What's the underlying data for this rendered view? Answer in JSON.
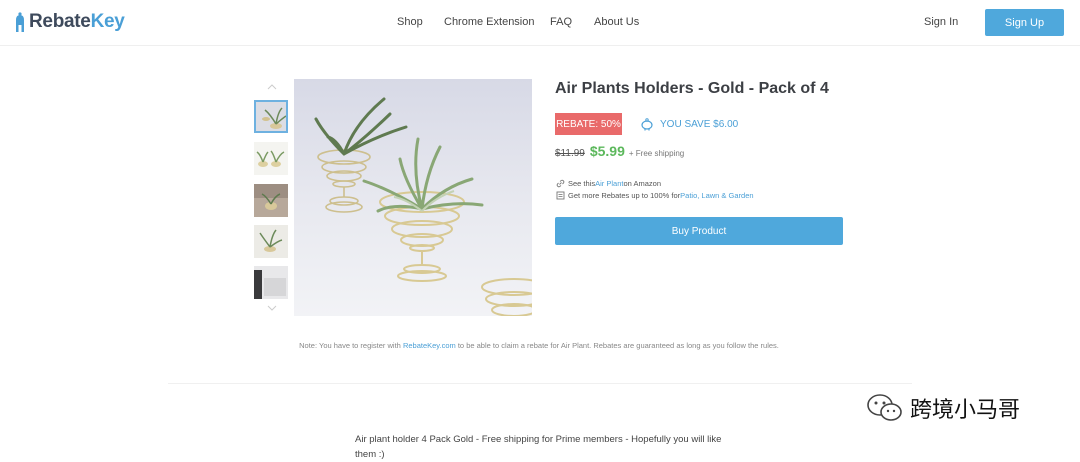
{
  "brand": {
    "name_part1": "Rebate",
    "name_part2": "Key"
  },
  "nav": {
    "items": [
      {
        "label": "Shop"
      },
      {
        "label": "Chrome Extension"
      },
      {
        "label": "FAQ"
      },
      {
        "label": "About Us"
      }
    ],
    "sign_in": "Sign In",
    "sign_up": "Sign Up"
  },
  "product": {
    "title": "Air Plants Holders - Gold - Pack of 4",
    "rebate_badge": "REBATE: 50%",
    "you_save": "YOU SAVE $6.00",
    "old_price": "$11.99",
    "new_price": "$5.99",
    "shipping": "+ Free shipping",
    "see_this_prefix": "See this ",
    "see_this_link": "Air Plant",
    "see_this_suffix": " on Amazon",
    "more_rebates_prefix": "Get more Rebates up to 100% for ",
    "more_rebates_link": "Patio, Lawn & Garden",
    "buy_button": "Buy Product",
    "thumbnail_count": 5,
    "active_thumbnail": 1
  },
  "note": {
    "prefix": "Note: You have to register with ",
    "link": "RebateKey.com",
    "suffix": " to be able to claim a rebate for Air Plant. Rebates are guaranteed as long as you follow the rules."
  },
  "description": "Air plant holder 4 Pack Gold - Free shipping for Prime members - Hopefully you will like them :)",
  "watermark": "跨境小马哥",
  "colors": {
    "accent": "#4fa8dc",
    "rebate_red": "#e96a6a",
    "price_green": "#5cb85c"
  }
}
